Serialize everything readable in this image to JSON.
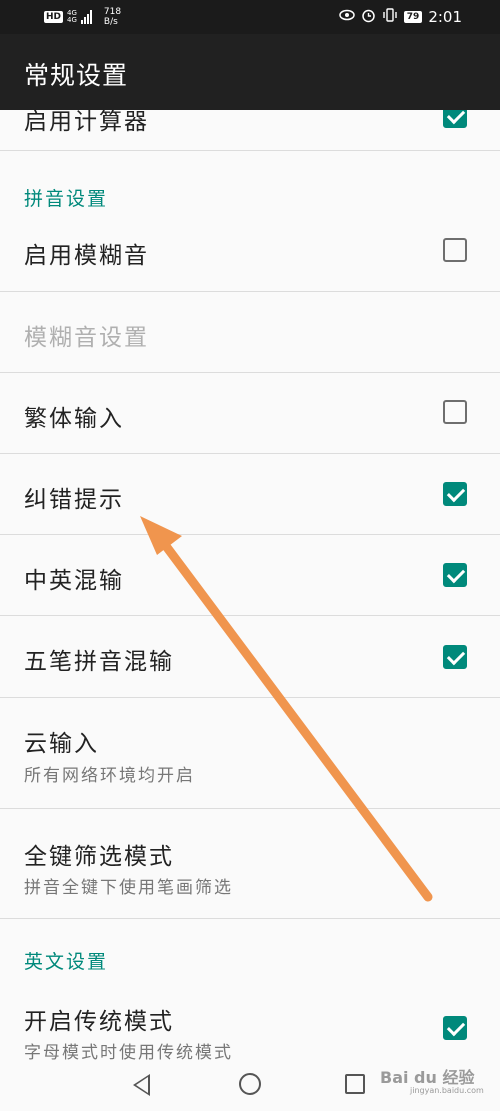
{
  "status_bar": {
    "hd": "HD",
    "network_top": "4G",
    "network_bottom": "4G",
    "speed_value": "718",
    "speed_unit": "B/s",
    "battery": "79",
    "time": "2:01"
  },
  "toolbar": {
    "title": "常规设置"
  },
  "rows_top": {
    "enable_calculator": {
      "label": "启用计算器",
      "checked": true
    }
  },
  "pinyin_section": {
    "header": "拼音设置",
    "fuzzy": {
      "label": "启用模糊音",
      "checked": false
    },
    "fuzzy_settings": {
      "label": "模糊音设置",
      "enabled": false
    },
    "traditional": {
      "label": "繁体输入",
      "checked": false
    },
    "correction": {
      "label": "纠错提示",
      "checked": true
    },
    "mixed_cn_en": {
      "label": "中英混输",
      "checked": true
    },
    "wubi_pinyin": {
      "label": "五笔拼音混输",
      "checked": true
    },
    "cloud": {
      "label": "云输入",
      "summary": "所有网络环境均开启"
    },
    "full_key": {
      "label": "全键筛选模式",
      "summary": "拼音全键下使用笔画筛选"
    }
  },
  "english_section": {
    "header": "英文设置",
    "traditional_mode": {
      "label": "开启传统模式",
      "summary": "字母模式时使用传统模式",
      "checked": true
    }
  },
  "watermark": {
    "main": "Bai du 经验",
    "sub": "jingyan.baidu.com"
  },
  "colors": {
    "accent": "#00897b",
    "toolbar": "#212121",
    "arrow": "#f0954e"
  }
}
